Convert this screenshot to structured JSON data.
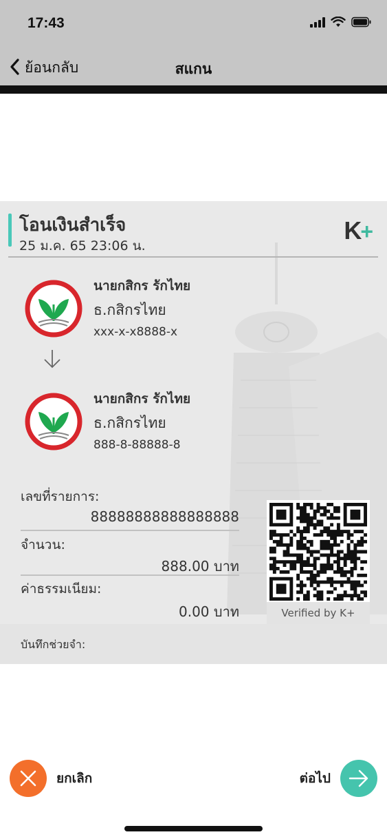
{
  "status_bar": {
    "time": "17:43",
    "icons": [
      "signal-icon",
      "wifi-icon",
      "battery-icon"
    ]
  },
  "nav": {
    "back_label": "ย้อนกลับ",
    "title": "สแกน"
  },
  "slip": {
    "title": "โอนเงินสำเร็จ",
    "date": "25 ม.ค. 65  23:06 น.",
    "brand": {
      "letter": "K",
      "plus": "+"
    },
    "sender": {
      "name": "นายกสิกร รักไทย",
      "bank": "ธ.กสิกรไทย",
      "account": "xxx-x-x8888-x"
    },
    "receiver": {
      "name": "นายกสิกร รักไทย",
      "bank": "ธ.กสิกรไทย",
      "account": "888-8-88888-8"
    },
    "reference": {
      "label": "เลขที่รายการ:",
      "value": "88888888888888888"
    },
    "amount": {
      "label": "จำนวน:",
      "value": "888.00 บาท"
    },
    "fee": {
      "label": "ค่าธรรมเนียม:",
      "value": "0.00 บาท"
    },
    "qr_caption": "Verified by K+",
    "memo_label": "บันทึกช่วยจำ:"
  },
  "actions": {
    "cancel_label": "ยกเลิก",
    "next_label": "ต่อไป"
  },
  "colors": {
    "accent": "#49c8b9",
    "cancel": "#f36f2b",
    "next": "#45c4ad",
    "bank_red": "#d8262c",
    "bank_green": "#1fa84f"
  }
}
